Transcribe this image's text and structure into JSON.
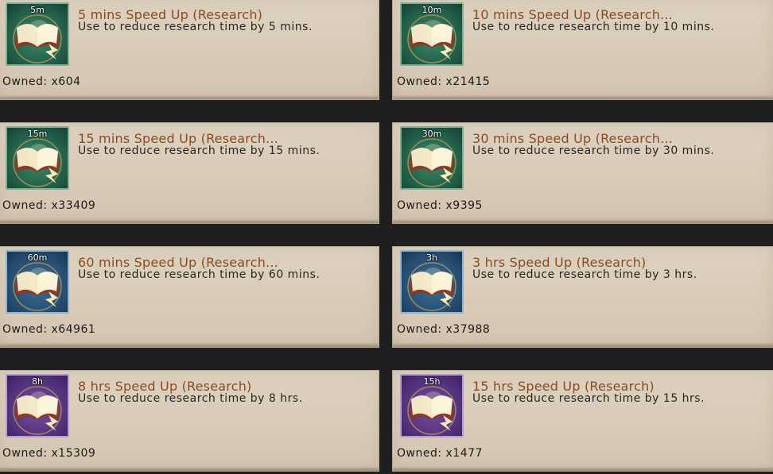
{
  "items": [
    {
      "badge": "5m",
      "title": "5 mins Speed Up (Research)",
      "description": "Use to reduce research time by 5 mins.",
      "owned": "Owned: x604",
      "icon": "research-book-icon",
      "rarity_color": "#2f7a5c"
    },
    {
      "badge": "10m",
      "title": "10 mins Speed Up (Research...",
      "description": "Use to reduce research time by 10 mins.",
      "owned": "Owned: x21415",
      "icon": "research-book-icon",
      "rarity_color": "#2f7a5c"
    },
    {
      "badge": "15m",
      "title": "15 mins Speed Up (Research...",
      "description": "Use to reduce research time by 15 mins.",
      "owned": "Owned: x33409",
      "icon": "research-book-icon",
      "rarity_color": "#2f7a5c"
    },
    {
      "badge": "30m",
      "title": "30 mins Speed Up (Research...",
      "description": "Use to reduce research time by 30 mins.",
      "owned": "Owned: x9395",
      "icon": "research-book-icon",
      "rarity_color": "#2f7a5c"
    },
    {
      "badge": "60m",
      "title": "60 mins Speed Up (Research...",
      "description": "Use to reduce research time by 60 mins.",
      "owned": "Owned: x64961",
      "icon": "research-book-icon",
      "rarity_color": "#355f88"
    },
    {
      "badge": "3h",
      "title": "3 hrs Speed Up (Research)",
      "description": "Use to reduce research time by 3 hrs.",
      "owned": "Owned: x37988",
      "icon": "research-book-icon",
      "rarity_color": "#355f88"
    },
    {
      "badge": "8h",
      "title": "8 hrs Speed Up (Research)",
      "description": "Use to reduce research time by 8 hrs.",
      "owned": "Owned: x15309",
      "icon": "research-book-icon",
      "rarity_color": "#6a3f96"
    },
    {
      "badge": "15h",
      "title": "15 hrs Speed Up (Research)",
      "description": "Use to reduce research time by 15 hrs.",
      "owned": "Owned: x1477",
      "icon": "research-book-icon",
      "rarity_color": "#6a3f96"
    }
  ]
}
